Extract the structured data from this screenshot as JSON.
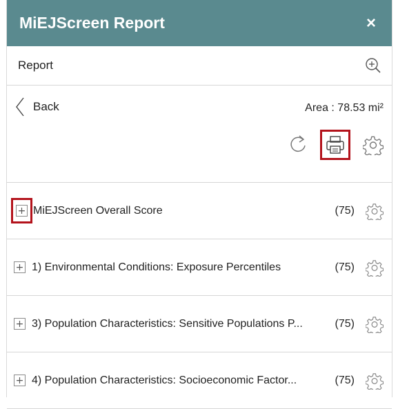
{
  "header": {
    "title": "MiEJScreen Report",
    "close_label": "×"
  },
  "subheader": {
    "label": "Report"
  },
  "toolbar": {
    "back_label": "Back",
    "area": "Area : 78.53 mi²"
  },
  "items": [
    {
      "label": "MiEJScreen Overall Score",
      "count": "(75)"
    },
    {
      "label": "1) Environmental Conditions: Exposure Percentiles",
      "count": "(75)"
    },
    {
      "label": "3) Population Characteristics: Sensitive Populations P...",
      "count": "(75)"
    },
    {
      "label": "4) Population Characteristics: Socioeconomic Factor...",
      "count": "(75)"
    }
  ],
  "colors": {
    "header_bg": "#5a8a8f",
    "highlight": "#b3121b"
  },
  "icons": [
    "close-icon",
    "zoom-in-icon",
    "back-chevron-icon",
    "refresh-icon",
    "print-icon",
    "gear-icon",
    "expand-plus-icon"
  ]
}
